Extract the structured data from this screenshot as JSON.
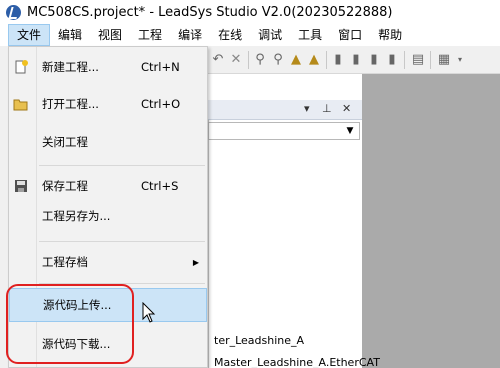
{
  "window": {
    "title": "MC508CS.project* - LeadSys Studio V2.0(20230522888)"
  },
  "menubar": [
    {
      "label": "文件",
      "active": true
    },
    {
      "label": "编辑"
    },
    {
      "label": "视图"
    },
    {
      "label": "工程"
    },
    {
      "label": "编译"
    },
    {
      "label": "在线"
    },
    {
      "label": "调试"
    },
    {
      "label": "工具"
    },
    {
      "label": "窗口"
    },
    {
      "label": "帮助"
    }
  ],
  "file_menu": {
    "new_project": {
      "label": "新建工程...",
      "shortcut": "Ctrl+N"
    },
    "open_project": {
      "label": "打开工程...",
      "shortcut": "Ctrl+O"
    },
    "close_project": {
      "label": "关闭工程"
    },
    "save_project": {
      "label": "保存工程",
      "shortcut": "Ctrl+S"
    },
    "save_as": {
      "label": "工程另存为..."
    },
    "archive": {
      "label": "工程存档"
    },
    "upload_source": {
      "label": "源代码上传..."
    },
    "download_source": {
      "label": "源代码下载..."
    }
  },
  "tree": {
    "line1": "ter_Leadshine_A",
    "line2": "Master_Leadshine_A.EtherCAT"
  },
  "colors": {
    "highlight": "#cce4f7",
    "annotation": "#e02020",
    "gray_area": "#aaaaaa"
  }
}
